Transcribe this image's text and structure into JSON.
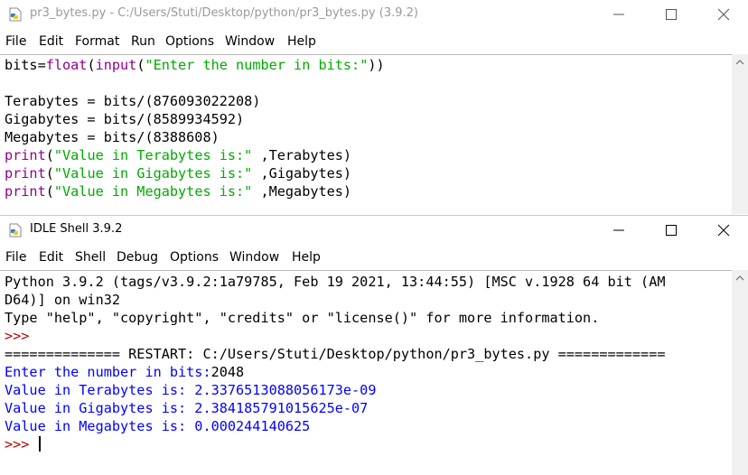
{
  "editor": {
    "title": "pr3_bytes.py - C:/Users/Stuti/Desktop/python/pr3_bytes.py (3.9.2)",
    "menu": [
      "File",
      "Edit",
      "Format",
      "Run",
      "Options",
      "Window",
      "Help"
    ],
    "code": {
      "l1a": "bits=",
      "l1b": "float",
      "l1c": "(",
      "l1d": "input",
      "l1e": "(",
      "l1f": "\"Enter the number in bits:\"",
      "l1g": "))",
      "l3": "Terabytes = bits/(876093022208)",
      "l4": "Gigabytes = bits/(8589934592)",
      "l5": "Megabytes = bits/(8388608)",
      "l6a": "print",
      "l6b": "(",
      "l6c": "\"Value in Terabytes is:\"",
      "l6d": " ,Terabytes)",
      "l7a": "print",
      "l7b": "(",
      "l7c": "\"Value in Gigabytes is:\"",
      "l7d": " ,Gigabytes)",
      "l8a": "print",
      "l8b": "(",
      "l8c": "\"Value in Megabytes is:\"",
      "l8d": " ,Megabytes)"
    }
  },
  "shell": {
    "title": "IDLE Shell 3.9.2",
    "menu": [
      "File",
      "Edit",
      "Shell",
      "Debug",
      "Options",
      "Window",
      "Help"
    ],
    "lines": {
      "banner1": "Python 3.9.2 (tags/v3.9.2:1a79785, Feb 19 2021, 13:44:55) [MSC v.1928 64 bit (AM",
      "banner2": "D64)] on win32",
      "banner3": "Type \"help\", \"copyright\", \"credits\" or \"license()\" for more information.",
      "prompt1": ">>>",
      "restart": "============== RESTART: C:/Users/Stuti/Desktop/python/pr3_bytes.py =============",
      "input_prompt": "Enter the number in bits:",
      "input_value": "2048",
      "out1": "Value in Terabytes is: 2.3376513088056173e-09",
      "out2": "Value in Gigabytes is: 2.384185791015625e-07",
      "out3": "Value in Megabytes is: 0.000244140625",
      "prompt2": ">>>"
    }
  },
  "colors": {
    "keyword": "#900090",
    "string": "#00aa00",
    "output": "#0000ff",
    "prompt": "#c00000"
  },
  "icons": {
    "window_icon": "python-file-icon",
    "minimize": "minimize-icon",
    "maximize": "maximize-icon",
    "close": "close-icon"
  }
}
